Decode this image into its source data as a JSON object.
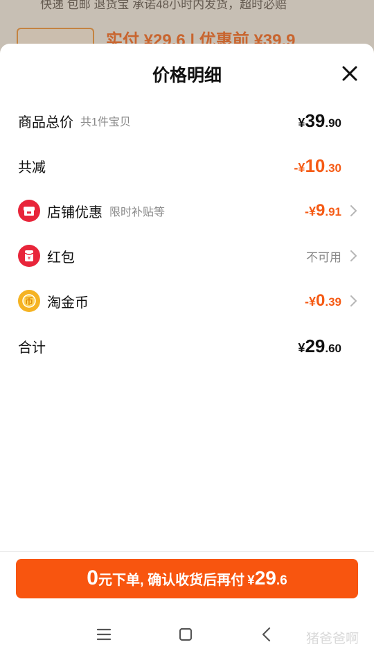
{
  "background": {
    "line1": "快递 包邮  退货宝  承诺48小时内发货，超时必赔",
    "price_text": "实付 ¥29.6  |  优惠前 ¥39.9"
  },
  "sheet": {
    "title": "价格明细",
    "rows": [
      {
        "label": "商品总价",
        "sub": "共1件宝贝",
        "yen": "¥",
        "int": "39",
        "dec": ".90"
      },
      {
        "label": "共减",
        "prefix": "-¥",
        "int": "10",
        "dec": ".30"
      },
      {
        "label": "店铺优惠",
        "sub": "限时补贴等",
        "prefix": "-¥",
        "int": "9",
        "dec": ".91",
        "icon": "shop-icon"
      },
      {
        "label": "红包",
        "status": "不可用",
        "icon": "red-packet-icon"
      },
      {
        "label": "淘金币",
        "prefix": "-¥",
        "int": "0",
        "dec": ".39",
        "icon": "coin-icon"
      },
      {
        "label": "合计",
        "yen": "¥",
        "int": "29",
        "dec": ".60"
      }
    ]
  },
  "pay_button": {
    "zero": "0",
    "text": "元下单, 确认收货后再付",
    "yen": "¥",
    "int": "29",
    "dec": ".6"
  },
  "navbar": {
    "watermark": "猪爸爸啊"
  },
  "colors": {
    "accent": "#f8550f",
    "discount": "#f55a14",
    "shop_icon": "#e8253a",
    "coin_icon": "#f5b323"
  }
}
